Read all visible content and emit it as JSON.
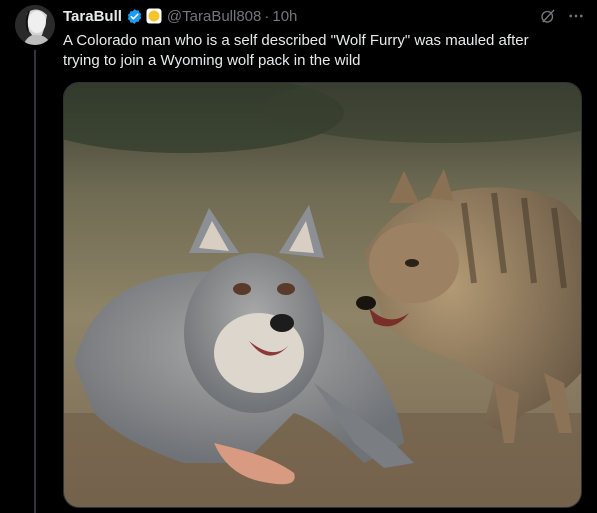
{
  "post": {
    "display_name": "TaraBull",
    "handle": "@TaraBull808",
    "separator": "·",
    "time": "10h",
    "text": "A Colorado man who is a self described \"Wolf Furry\" was mauled after trying to join a Wyoming wolf pack in the wild",
    "verified_badge_icon": "verified-check-icon",
    "affiliate_badge_icon": "gold-circle-badge-icon",
    "grok_icon": "grok-icon",
    "more_icon": "more-dots-icon"
  },
  "colors": {
    "background": "#000000",
    "primary_text": "#e7e9ea",
    "secondary_text": "#71767b",
    "verified_blue": "#1d9bf0",
    "gold_badge": "#f4c430",
    "thread_line": "#333639"
  }
}
